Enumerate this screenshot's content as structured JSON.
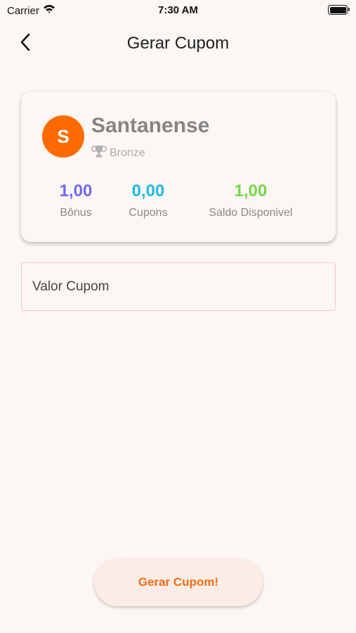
{
  "status_bar": {
    "carrier": "Carrier",
    "time": "7:30 AM"
  },
  "nav": {
    "title": "Gerar Cupom"
  },
  "profile": {
    "avatar_letter": "S",
    "name": "Santanense",
    "rank": "Bronze"
  },
  "stats": [
    {
      "value": "1,00",
      "label": "Bônus",
      "color": "#6e6af0"
    },
    {
      "value": "0,00",
      "label": "Cupons",
      "color": "#20b8e8"
    },
    {
      "value": "1,00",
      "label": "Saldo Disponivel",
      "color": "#77d64a"
    }
  ],
  "form": {
    "coupon_placeholder": "Valor Cupom"
  },
  "actions": {
    "generate_label": "Gerar Cupom!"
  },
  "colors": {
    "accent": "#ff6a00",
    "background": "#fdf7f4"
  }
}
